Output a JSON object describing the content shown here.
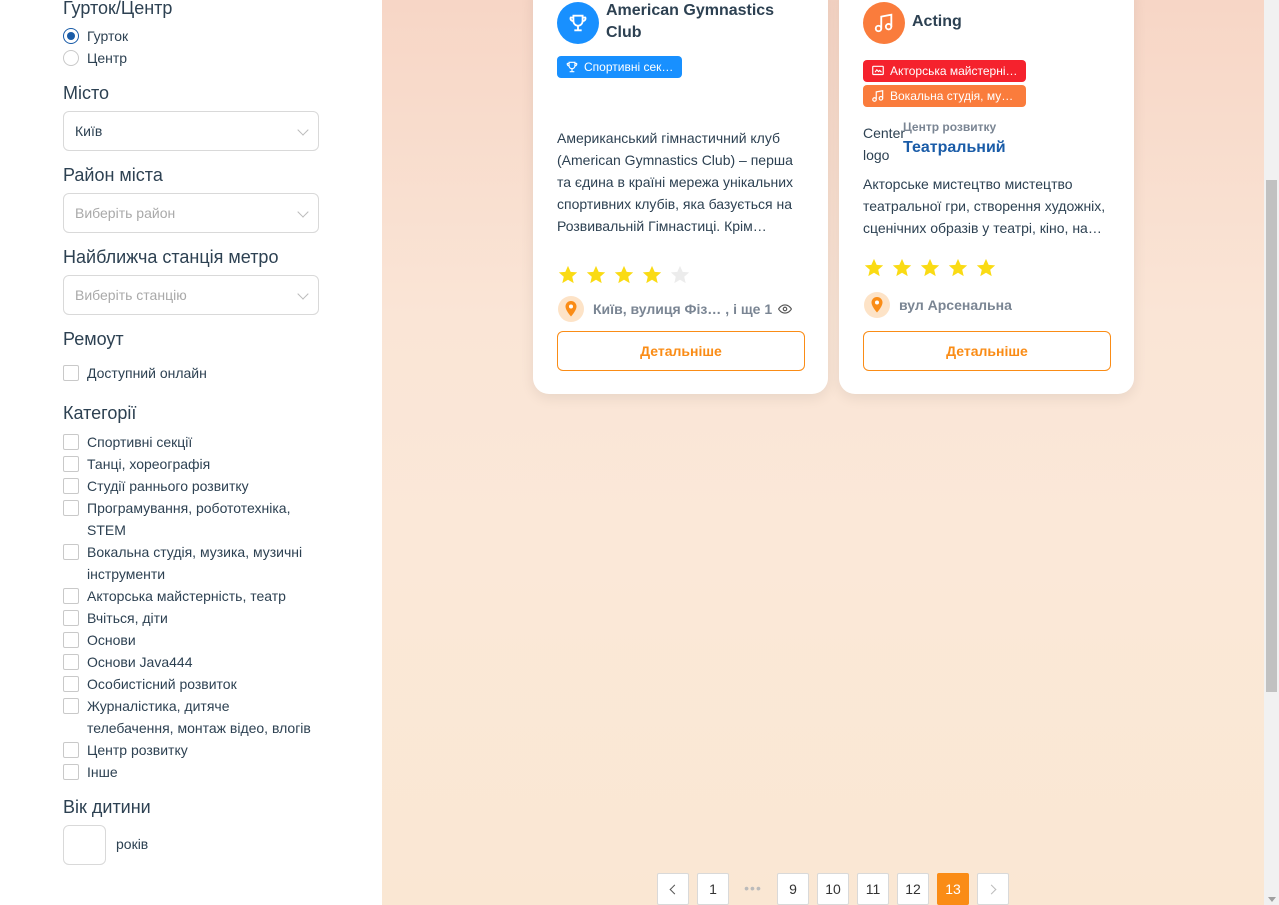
{
  "filters": {
    "type_title": "Гурток/Центр",
    "type_options": [
      "Гурток",
      "Центр"
    ],
    "type_selected": "Гурток",
    "city_title": "Місто",
    "city_value": "Київ",
    "district_title": "Район міста",
    "district_placeholder": "Виберіть район",
    "metro_title": "Найближча станція метро",
    "metro_placeholder": "Виберіть станцію",
    "remote_title": "Ремоут",
    "remote_option": "Доступний онлайн",
    "categories_title": "Категорії",
    "categories": [
      "Спортивні секції",
      "Танці, хореографія",
      "Студії раннього розвитку",
      "Програмування, робототехніка, STEM",
      "Вокальна студія, музика, музичні інструменти",
      "Акторська майстерність, театр",
      "Вчіться, діти",
      "Основи",
      "Основи Java444",
      "Особистісний розвиток",
      "Журналістика, дитяче телебачення, монтаж відео, влогів",
      "Центр розвитку",
      "Інше"
    ],
    "age_title": "Вік дитини",
    "age_unit": "років"
  },
  "cards": [
    {
      "title": "American Gymnastics Club",
      "icon": "trophy-icon",
      "icon_color": "#1890ff",
      "tags": [
        {
          "label": "Спортивні секції",
          "color": "#1890ff",
          "icon": "trophy-icon"
        }
      ],
      "description": "Американський гімнастичний клуб (American Gymnastics Club) – перша та єдина в країні мережа унікальних спортивних клубів, яка базується на Розвивальній Гімнастиці. Крім…",
      "rating": 4,
      "address": "Київ, вулиця Фіз…",
      "address_more": ", і ще 1",
      "button": "Детальніше"
    },
    {
      "title": "Acting",
      "icon": "music-note-icon",
      "icon_color": "#fa7c3c",
      "tags": [
        {
          "label": "Акторська майстерні…",
          "color": "#f5222d",
          "icon": "theatre-icon"
        },
        {
          "label": "Вокальна студія, му…",
          "color": "#fa7c3c",
          "icon": "music-note-icon"
        }
      ],
      "center_label": "Центр розвитку",
      "center_name": "Театральний",
      "center_logo_alt": "Center logo",
      "description": "Акторське мистецтво мистецтво театральної гри, створення художніх, сценічних образів у театрі, кіно, на…",
      "rating": 5,
      "address": "вул Арсенальна",
      "button": "Детальніше"
    }
  ],
  "pagination": {
    "pages": [
      "1",
      "•••",
      "9",
      "10",
      "11",
      "12",
      "13"
    ],
    "current": "13"
  },
  "colors": {
    "accent": "#fa8c16",
    "primary": "#1890ff",
    "star": "#fadb14"
  }
}
